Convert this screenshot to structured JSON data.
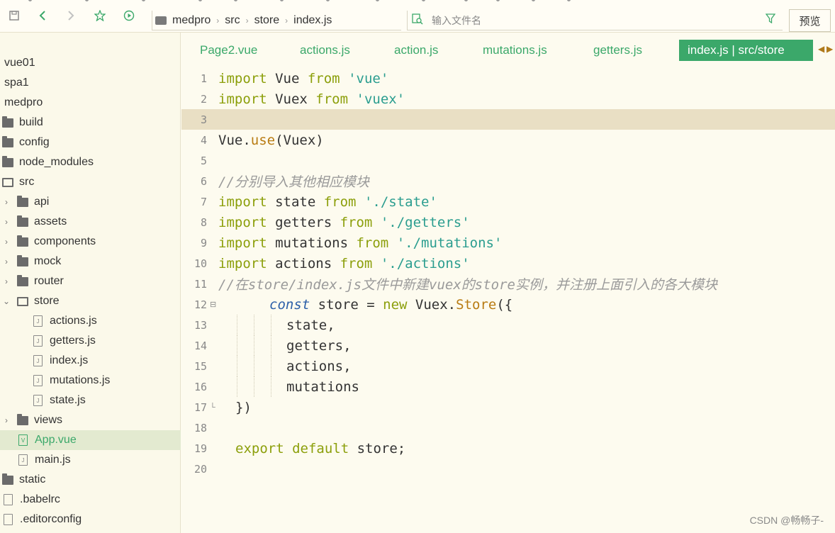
{
  "toolbar": {
    "breadcrumb": [
      "medpro",
      "src",
      "store",
      "index.js"
    ],
    "file_search_placeholder": "输入文件名",
    "preview_label": "预览"
  },
  "sidebar": {
    "items": [
      {
        "label": "vue01",
        "type": "project"
      },
      {
        "label": "spa1",
        "type": "project"
      },
      {
        "label": "medpro",
        "type": "project"
      },
      {
        "label": "build",
        "type": "folder"
      },
      {
        "label": "config",
        "type": "folder"
      },
      {
        "label": "node_modules",
        "type": "folder"
      },
      {
        "label": "src",
        "type": "folder-open"
      },
      {
        "label": "api",
        "type": "folder"
      },
      {
        "label": "assets",
        "type": "folder"
      },
      {
        "label": "components",
        "type": "folder"
      },
      {
        "label": "mock",
        "type": "folder"
      },
      {
        "label": "router",
        "type": "folder"
      },
      {
        "label": "store",
        "type": "folder-open"
      },
      {
        "label": "actions.js",
        "type": "file"
      },
      {
        "label": "getters.js",
        "type": "file"
      },
      {
        "label": "index.js",
        "type": "file"
      },
      {
        "label": "mutations.js",
        "type": "file"
      },
      {
        "label": "state.js",
        "type": "file"
      },
      {
        "label": "views",
        "type": "folder"
      },
      {
        "label": "App.vue",
        "type": "vue-file",
        "selected": true
      },
      {
        "label": "main.js",
        "type": "file"
      },
      {
        "label": "static",
        "type": "folder"
      },
      {
        "label": ".babelrc",
        "type": "plain-file"
      },
      {
        "label": ".editorconfig",
        "type": "plain-file"
      }
    ]
  },
  "tabs": [
    {
      "label": "Page2.vue"
    },
    {
      "label": "actions.js"
    },
    {
      "label": "action.js"
    },
    {
      "label": "mutations.js"
    },
    {
      "label": "getters.js"
    },
    {
      "label": "index.js | src/store",
      "active": true
    }
  ],
  "editor": {
    "line_numbers": [
      "1",
      "2",
      "3",
      "4",
      "5",
      "6",
      "7",
      "8",
      "9",
      "10",
      "11",
      "12",
      "13",
      "14",
      "15",
      "16",
      "17",
      "18",
      "19",
      "20"
    ],
    "lines": {
      "l1": {
        "kw": "import",
        "a": " Vue ",
        "kw2": "from",
        "b": " ",
        "str": "'vue'"
      },
      "l2": {
        "kw": "import",
        "a": " Vuex ",
        "kw2": "from",
        "b": " ",
        "str": "'vuex'"
      },
      "l4": {
        "a": "Vue.",
        "fn": "use",
        "b": "(Vuex)"
      },
      "l6": {
        "cmt": "//分别导入其他相应模块"
      },
      "l7": {
        "kw": "import",
        "a": " state ",
        "kw2": "from",
        "b": " ",
        "str": "'./state'"
      },
      "l8": {
        "kw": "import",
        "a": " getters ",
        "kw2": "from",
        "b": " ",
        "str": "'./getters'"
      },
      "l9": {
        "kw": "import",
        "a": " mutations ",
        "kw2": "from",
        "b": " ",
        "str": "'./mutations'"
      },
      "l10": {
        "kw": "import",
        "a": " actions ",
        "kw2": "from",
        "b": " ",
        "str": "'./actions'"
      },
      "l11": {
        "cmt": "//在store/index.js文件中新建vuex的store实例，并注册上面引入的各大模块"
      },
      "l12": {
        "const": "const",
        "a": " store = ",
        "kw": "new",
        "b": " Vuex.",
        "fn": "Store",
        "c": "({"
      },
      "l13": {
        "a": "state,"
      },
      "l14": {
        "a": "getters,"
      },
      "l15": {
        "a": "actions,"
      },
      "l16": {
        "a": "mutations"
      },
      "l17": {
        "a": "})"
      },
      "l19": {
        "kw": "export",
        "kw2": " default",
        "a": " store;"
      }
    }
  },
  "watermark": "CSDN @畅畅子-"
}
